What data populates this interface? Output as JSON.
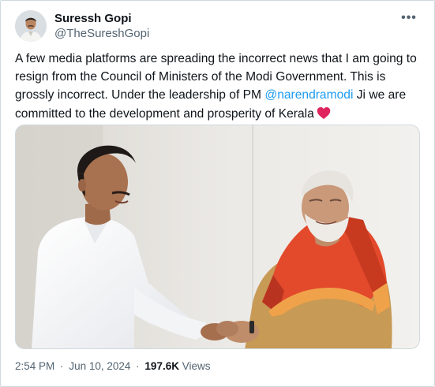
{
  "author": {
    "display_name": "Suressh Gopi",
    "handle": "@TheSureshGopi",
    "avatar": "profile-photo"
  },
  "more_icon": "more-horizontal-icon",
  "tweet": {
    "text_before_mention": "A few media platforms are spreading the incorrect news that I am going to resign from the Council of Ministers of the Modi Government. This is grossly incorrect. Under the leadership of PM ",
    "mention": "@narendramodi",
    "text_after_mention": " Ji we are committed to the development and prosperity of Kerala",
    "emoji": "red-heart-icon",
    "media": "photo-two-men-greeting-handshake"
  },
  "meta": {
    "time": "2:54 PM",
    "separator": "·",
    "date": "Jun 10, 2024",
    "views_count": "197.6K",
    "views_label": "Views"
  },
  "colors": {
    "text": "#0f1419",
    "secondary": "#536471",
    "link": "#1d9bf0",
    "border": "#cfd9de",
    "heart": "#e0245e"
  }
}
